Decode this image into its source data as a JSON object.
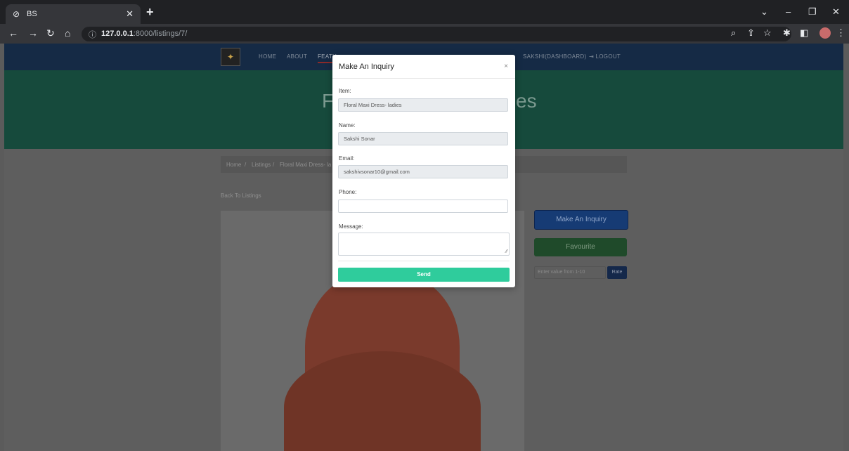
{
  "browser": {
    "tab_title": "BS",
    "tab_favicon": "globe-icon",
    "url_host": "127.0.0.1",
    "url_rest": ":8000/listings/7/"
  },
  "navbar": {
    "links": [
      "HOME",
      "ABOUT",
      "FEATU",
      "SAKSHI(DASHBOARD)",
      "LOGOUT"
    ]
  },
  "hero": {
    "title_left": "F",
    "title_right": "es"
  },
  "breadcrumb": {
    "home": "Home",
    "sep": "/",
    "listings": "Listings",
    "current": "Floral Maxi Dress- la"
  },
  "back_link": "Back To Listings",
  "sidebar": {
    "inquiry_button": "Make An Inquiry",
    "favourite_button": "Favourite",
    "rate_placeholder": "Enter value from 1-10",
    "rate_button": "Rate"
  },
  "modal": {
    "title": "Make An Inquiry",
    "close": "×",
    "item_label": "Item:",
    "item_value": "Floral Maxi Dress- ladies",
    "name_label": "Name:",
    "name_value": "Sakshi Sonar",
    "email_label": "Email:",
    "email_value": "sakshivsonar10@gmail.com",
    "phone_label": "Phone:",
    "phone_value": "",
    "message_label": "Message:",
    "send_button": "Send"
  },
  "colors": {
    "navbar": "#152a45",
    "hero": "#164a3c",
    "send": "#2fcc9c",
    "inquiry": "#163b74",
    "favourite": "#1f4a2a"
  }
}
